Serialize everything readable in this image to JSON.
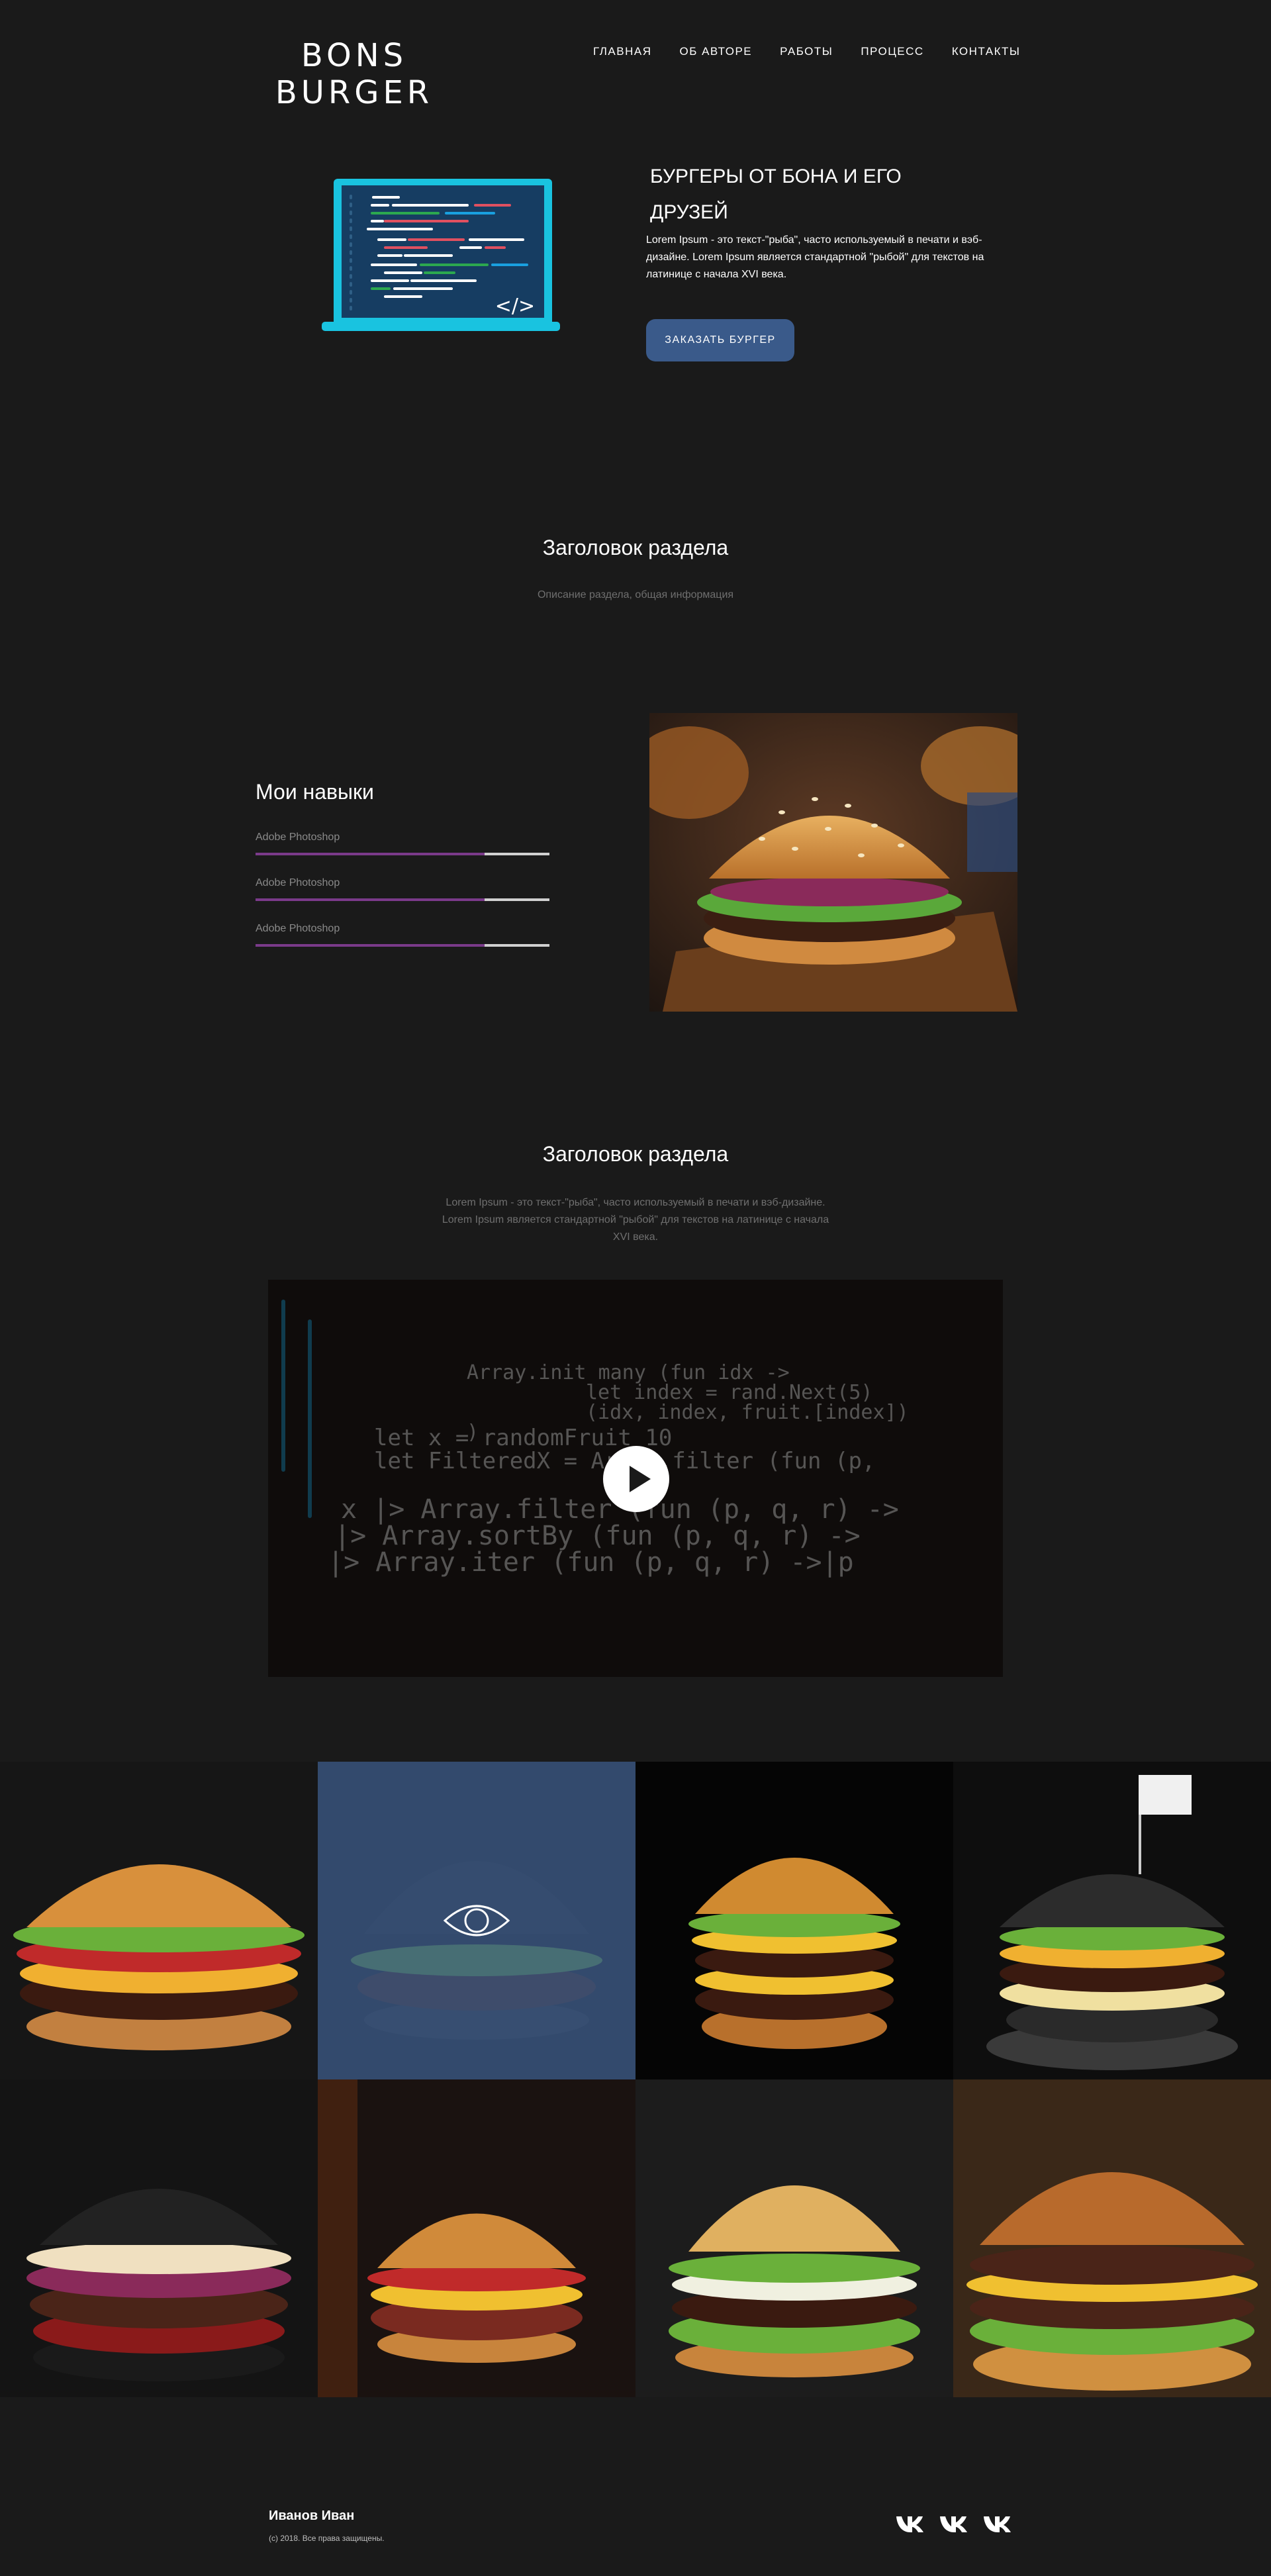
{
  "header": {
    "logo_line1": "BONS",
    "logo_line2": "BURGER",
    "nav": [
      "ГЛАВНАЯ",
      "ОБ АВТОРЕ",
      "РАБОТЫ",
      "ПРОЦЕСС",
      "КОНТАКТЫ"
    ]
  },
  "hero": {
    "title_line1": "БУРГЕРЫ ОТ БОНА И ЕГО",
    "title_line2": "ДРУЗЕЙ",
    "text": "Lorem Ipsum - это текст-\"рыба\", часто используемый в печати и вэб-дизайне. Lorem Ipsum является стандартной \"рыбой\" для текстов на латинице с начала XVI века.",
    "button": "ЗАКАЗАТЬ БУРГЕР",
    "laptop_code_tag": "</>"
  },
  "section1": {
    "title": "Заголовок раздела",
    "description": "Описание раздела, общая информация"
  },
  "skills": {
    "title": "Мои навыки",
    "items": [
      {
        "label": "Adobe Photoshop",
        "level": 0.78
      },
      {
        "label": "Adobe Photoshop",
        "level": 0.78
      },
      {
        "label": "Adobe Photoshop",
        "level": 0.78
      }
    ]
  },
  "section2": {
    "title": "Заголовок раздела",
    "text": "Lorem Ipsum - это текст-\"рыба\", часто используемый в печати и вэб-дизайне. Lorem Ipsum является стандартной \"рыбой\" для текстов на латинице с начала XVI века."
  },
  "video": {
    "code_lines": [
      "Array.init many (fun idx ->",
      "    let index = rand.Next(5)",
      "    (idx, index, fruit.[index])",
      ")",
      "let x = randomFruit 10",
      "let FilteredX = Array.filter (fun (p,",
      "x |> Array.filter (fun (p, q, r) ->",
      "|> Array.sortBy (fun (p, q, r) ->",
      "|> Array.iter (fun (p, q, r) ->|p"
    ]
  },
  "footer": {
    "name": "Иванов Иван",
    "copyright": "(c) 2018. Все права защищены.",
    "socials": [
      "vk",
      "vk",
      "vk"
    ]
  },
  "colors": {
    "background": "#1a1a1a",
    "accent_button": "#3a5a8a",
    "skill_fill": "#7a3a8a",
    "laptop_frame": "#19c3e0"
  }
}
